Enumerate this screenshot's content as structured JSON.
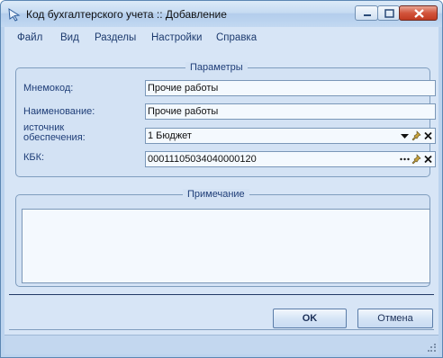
{
  "window": {
    "title": "Код бухгалтерского учета :: Добавление",
    "app_icon": "arrow-app-icon",
    "controls": [
      "minimize-icon",
      "maximize-icon",
      "close-icon"
    ]
  },
  "menu": {
    "items": [
      {
        "label": "Файл"
      },
      {
        "label": "Вид"
      },
      {
        "label": "Разделы"
      },
      {
        "label": "Настройки"
      },
      {
        "label": "Справка"
      }
    ]
  },
  "parameters": {
    "legend": "Параметры",
    "mnemocode": {
      "label": "Мнемокод:",
      "value": "Прочие работы"
    },
    "name": {
      "label": "Наименование:",
      "value": "Прочие работы"
    },
    "source": {
      "label_line1": "источник",
      "label_line2": "обеспечения:",
      "value": "1 Бюджет",
      "icons": [
        "dropdown-arrow-icon",
        "pin-icon",
        "clear-icon"
      ]
    },
    "kbk": {
      "label": "КБК:",
      "value": "00011105034040000120",
      "icons": [
        "ellipsis-icon",
        "pin-icon",
        "clear-icon"
      ]
    }
  },
  "note": {
    "legend": "Примечание",
    "value": ""
  },
  "buttons": {
    "ok": "OK",
    "cancel": "Отмена"
  },
  "colors": {
    "client_bg": "#d7e5f6",
    "group_border": "#7f9dbe",
    "label_text": "#1f3e78",
    "close_button": "#c13a20"
  }
}
